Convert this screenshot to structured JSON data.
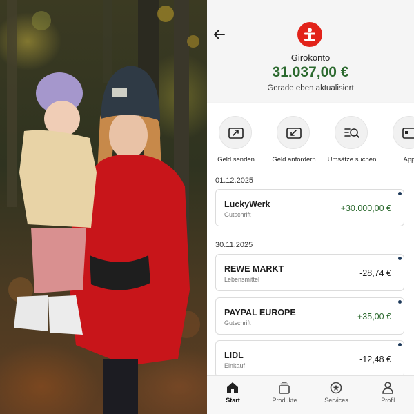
{
  "header": {
    "account_name": "Girokonto",
    "balance": "31.037,00 €",
    "status": "Gerade eben aktualisiert"
  },
  "actions": [
    {
      "label": "Geld senden",
      "icon": "send-money-icon"
    },
    {
      "label": "Geld anfordern",
      "icon": "request-money-icon"
    },
    {
      "label": "Umsätze suchen",
      "icon": "search-transactions-icon"
    },
    {
      "label": "Appl",
      "icon": "card-icon"
    }
  ],
  "groups": [
    {
      "date": "01.12.2025",
      "transactions": [
        {
          "name": "LuckyWerk",
          "category": "Gutschrift",
          "amount": "+30.000,00 €"
        }
      ]
    },
    {
      "date": "30.11.2025",
      "transactions": [
        {
          "name": "REWE MARKT",
          "category": "Lebensmittel",
          "amount": "-28,74 €"
        },
        {
          "name": "PAYPAL EUROPE",
          "category": "Gutschrift",
          "amount": "+35,00 €"
        },
        {
          "name": "LIDL",
          "category": "Einkauf",
          "amount": "-12,48 €"
        }
      ]
    }
  ],
  "tabs": [
    {
      "label": "Start",
      "icon": "home-icon",
      "active": true
    },
    {
      "label": "Produkte",
      "icon": "products-icon"
    },
    {
      "label": "Services",
      "icon": "services-icon"
    },
    {
      "label": "Profil",
      "icon": "profile-icon"
    }
  ],
  "colors": {
    "brand_red": "#e2231a",
    "positive_green": "#2c6a2f"
  }
}
